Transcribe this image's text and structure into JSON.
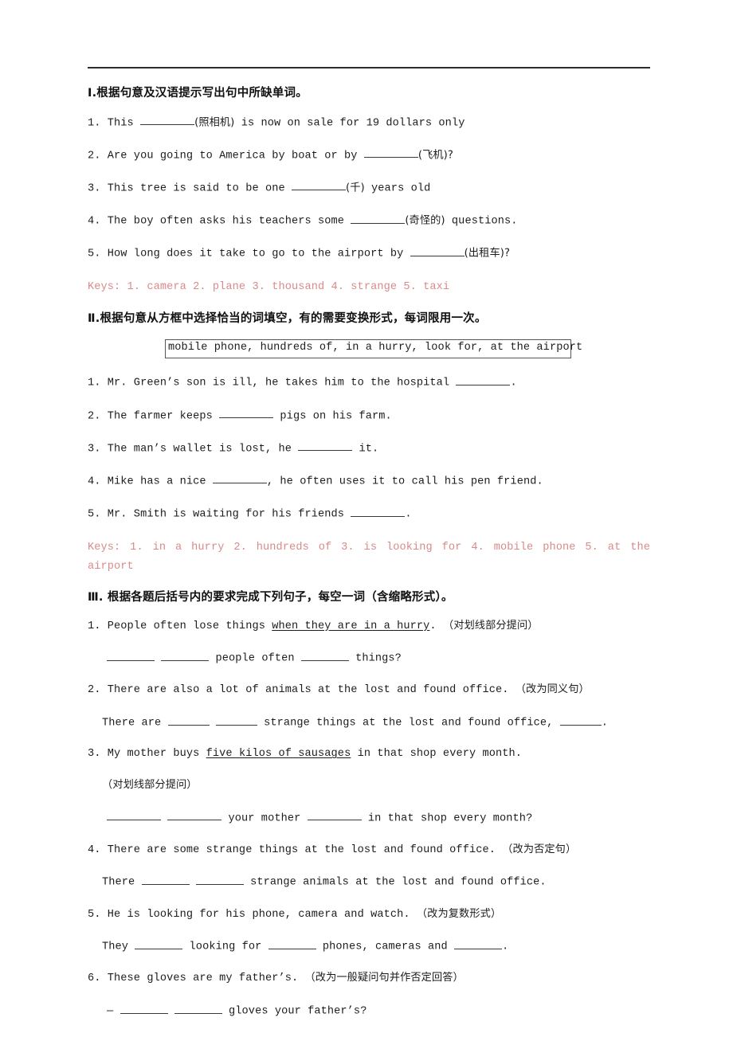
{
  "document": {
    "sections": [
      {
        "id": "section-1",
        "heading": "Ⅰ.根据句意及汉语提示写出句中所缺单词。",
        "items": [
          {
            "num": "1.",
            "pre": "This ",
            "hint": "(照相机)",
            "post": " is now on sale for 19 dollars only"
          },
          {
            "num": "2.",
            "pre": "Are you going to America by boat or by ",
            "hint": "(飞机)?",
            "post": ""
          },
          {
            "num": "3.",
            "pre": "This tree is said to be one ",
            "hint": "(千)",
            "post": " years old"
          },
          {
            "num": "4.",
            "pre": "The boy often asks his teachers some ",
            "hint": "(奇怪的)",
            "post": " questions."
          },
          {
            "num": "5.",
            "pre": "How long does it take to go to the airport by ",
            "hint": "(出租车)?",
            "post": ""
          }
        ],
        "keys": "Keys: 1. camera  2. plane  3. thousand  4. strange  5. taxi"
      },
      {
        "id": "section-2",
        "heading": "Ⅱ.根据句意从方框中选择恰当的词填空，有的需要变换形式，每词限用一次。",
        "wordbox": "mobile phone, hundreds of, in a hurry, look for, at the airport",
        "items": [
          {
            "num": "1.",
            "pre": "Mr. Green’s son is ill, he takes him to the hospital ",
            "post": "."
          },
          {
            "num": "2.",
            "pre": "The farmer keeps ",
            "post": " pigs on his farm."
          },
          {
            "num": "3.",
            "pre": "The man’s wallet is lost, he ",
            "post": " it."
          },
          {
            "num": "4.",
            "pre": "Mike has a nice ",
            "post": ", he often uses it to call his pen friend."
          },
          {
            "num": "5.",
            "pre": "Mr. Smith is waiting for his friends ",
            "post": "."
          }
        ],
        "keys": "Keys: 1. in a hurry  2. hundreds of 3. is looking for 4. mobile phone 5. at the airport"
      },
      {
        "id": "section-3",
        "heading": "Ⅲ. 根据各题后括号内的要求完成下列句子，每空一词（含缩略形式）。",
        "items": [
          {
            "num": "1.",
            "q_pre": "People often lose things ",
            "q_ul": "when they are in a hurry",
            "q_post": ". ",
            "q_cn": "（对划线部分提问）",
            "a_parts": [
              "",
              " ",
              " people often ",
              " things?"
            ]
          },
          {
            "num": "2.",
            "q_pre": "There are also a lot of animals at the lost and found office. ",
            "q_ul": "",
            "q_post": "",
            "q_cn": "（改为同义句）",
            "a_parts": [
              "There are ",
              " ",
              " strange things at the lost and found office, ",
              "."
            ]
          },
          {
            "num": "3.",
            "q_pre": "My mother buys ",
            "q_ul": "five kilos of sausages",
            "q_post": " in that shop every month.",
            "q_cn": "（对划线部分提问）",
            "a_parts": [
              "",
              " ",
              " your mother ",
              " in that shop every month?"
            ]
          },
          {
            "num": "4.",
            "q_pre": "There are some strange things at the lost and found office. ",
            "q_ul": "",
            "q_post": "",
            "q_cn": "（改为否定句）",
            "a_parts": [
              "There ",
              " ",
              " strange animals at the lost and found office."
            ]
          },
          {
            "num": "5.",
            "q_pre": "He is looking for his phone, camera and watch. ",
            "q_ul": "",
            "q_post": "",
            "q_cn": "（改为复数形式）",
            "a_parts": [
              "They ",
              " looking for ",
              " phones, cameras and ",
              "."
            ]
          },
          {
            "num": "6.",
            "q_pre": "These gloves are my father’s.        ",
            "q_ul": "",
            "q_post": "",
            "q_cn": "（改为一般疑问句并作否定回答）",
            "a_parts": [
              "— ",
              " ",
              " gloves your father’s?"
            ]
          }
        ]
      }
    ]
  },
  "colors": {
    "key_red": "#d98a8a",
    "text": "#1c1c1c",
    "rule": "#2b2b2b",
    "box_border": "#555555"
  }
}
